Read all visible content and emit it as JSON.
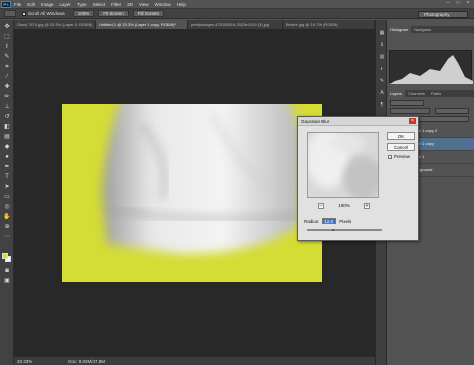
{
  "menubar": {
    "logo": "Ps",
    "items": [
      "File",
      "Edit",
      "Image",
      "Layer",
      "Type",
      "Select",
      "Filter",
      "3D",
      "View",
      "Window",
      "Help"
    ],
    "window_controls": [
      "–",
      "□",
      "×"
    ]
  },
  "options": {
    "scroll_all_label": "Scroll All Windows",
    "buttons": [
      "100%",
      "Fit Screen",
      "Fill Screen"
    ],
    "workspace": "Photography"
  },
  "tabs": [
    {
      "label": "Stock 7474 jpg @ 33.3% (Layer 0, RGB/8)",
      "active": false
    },
    {
      "label": "Untitled-1 @ 33.3% (Layer 1 copy, RGB/8)*",
      "active": true
    },
    {
      "label": "prettyimages-475108519-2023e1019 (3).jpg",
      "active": false
    },
    {
      "label": "Before.jpg @ 16.7% (RGB/8)",
      "active": false
    }
  ],
  "status": {
    "zoom": "33.33%",
    "doc": "Doc: 9.02M/47.8M"
  },
  "panels": {
    "top_tabs": [
      "Histogram",
      "Navigator"
    ],
    "layer_tabs": [
      "Layers",
      "Channels",
      "Paths"
    ],
    "layers": [
      {
        "name": "Layer 1 copy 2",
        "selected": false
      },
      {
        "name": "Layer 1 copy",
        "selected": true
      },
      {
        "name": "Layer 1",
        "selected": false
      },
      {
        "name": "Background",
        "selected": false
      }
    ]
  },
  "dialog": {
    "title": "Gaussian Blur",
    "close": "×",
    "ok": "OK",
    "cancel": "Cancel",
    "preview_label": "Preview",
    "preview_checked": true,
    "zoom_out": "−",
    "zoom_level": "100%",
    "zoom_in": "+",
    "radius_label": "Radius:",
    "radius_value": "12.0",
    "radius_unit": "Pixels",
    "radius_fraction": 0.35
  },
  "colors": {
    "canvas_bg": "#d5dc34",
    "foreground": "#d7df2a",
    "background": "#ffffff",
    "accent": "#2f8fd8"
  }
}
